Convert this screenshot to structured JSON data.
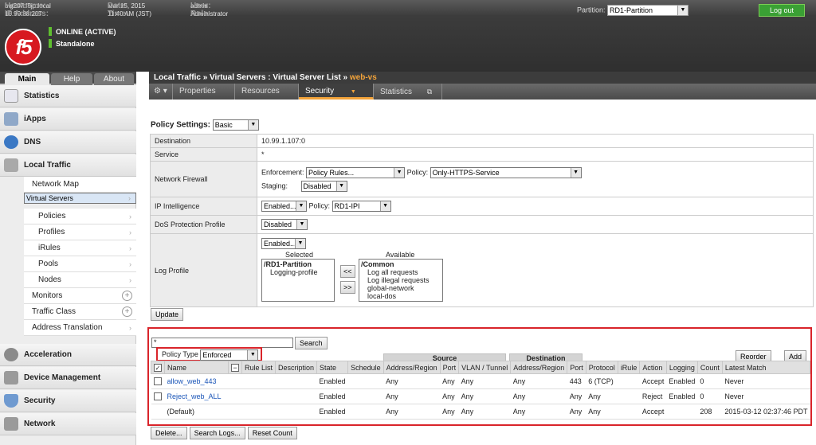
{
  "header": {
    "hostname_label": "Hostname:",
    "hostname": "big207.f5jp.local",
    "ip_label": "IP Address:",
    "ip": "10.99.88.207",
    "date_label": "Date:",
    "date": "Mar 15, 2015",
    "time_label": "Time:",
    "time": "11:40 AM (JST)",
    "user_label": "User:",
    "user": "admin",
    "role_label": "Role:",
    "role": "Administrator",
    "logo": "f5",
    "status_line1": "ONLINE (ACTIVE)",
    "status_line2": "Standalone",
    "partition_label": "Partition:",
    "partition_value": "RD1-Partition",
    "logout": "Log out"
  },
  "sidebar": {
    "tabs": [
      "Main",
      "Help",
      "About"
    ],
    "items": [
      {
        "label": "Statistics",
        "icon": "statistics-icon"
      },
      {
        "label": "iApps",
        "icon": "iapps-icon"
      },
      {
        "label": "DNS",
        "icon": "dns-icon"
      },
      {
        "label": "Local Traffic",
        "icon": "local-traffic-icon"
      }
    ],
    "local_traffic": [
      "Network Map",
      "Virtual Servers",
      "Policies",
      "Profiles",
      "iRules",
      "Pools",
      "Nodes",
      "Monitors",
      "Traffic Class",
      "Address Translation"
    ],
    "bottom": [
      {
        "label": "Acceleration",
        "icon": "acceleration-icon"
      },
      {
        "label": "Device Management",
        "icon": "device-management-icon"
      },
      {
        "label": "Security",
        "icon": "security-icon"
      },
      {
        "label": "Network",
        "icon": "network-icon"
      }
    ]
  },
  "page": {
    "crumb1": "Local Traffic",
    "sep": "»",
    "crumb2": "Virtual Servers : Virtual Server List",
    "current": "web-vs",
    "tabs": [
      "Properties",
      "Resources",
      "Security",
      "Statistics"
    ],
    "gear": "⚙ ▾"
  },
  "policy": {
    "settings_label": "Policy Settings:",
    "settings_value": "Basic",
    "rows": {
      "destination_label": "Destination",
      "destination": "10.99.1.107:0",
      "service_label": "Service",
      "service": "*",
      "firewall_label": "Network Firewall",
      "enforcement_label": "Enforcement:",
      "enforcement": "Policy Rules...",
      "policy_label": "Policy:",
      "fw_policy": "Only-HTTPS-Service",
      "staging_label": "Staging:",
      "staging": "Disabled",
      "ipi_label": "IP Intelligence",
      "ipi_enabled": "Enabled...",
      "ipi_policy_label": "Policy:",
      "ipi_policy": "RD1-IPI",
      "dos_label": "DoS Protection Profile",
      "dos": "Disabled",
      "log_label": "Log Profile",
      "log_enabled": "Enabled...",
      "selected_label": "Selected",
      "available_label": "Available",
      "selected": [
        "/RD1-Partition",
        "Logging-profile"
      ],
      "available": [
        "/Common",
        "Log all requests",
        "Log illegal requests",
        "global-network",
        "local-dos"
      ],
      "move_left": "<<",
      "move_right": ">>"
    },
    "update": "Update"
  },
  "rules": {
    "search_value": "*",
    "search_btn": "Search",
    "policy_type_label": "Policy Type",
    "policy_type": "Enforced",
    "reorder": "Reorder",
    "add": "Add",
    "group_source": "Source",
    "group_destination": "Destination",
    "columns": [
      "Name",
      "Rule List",
      "Description",
      "State",
      "Schedule",
      "Address/Region",
      "Port",
      "VLAN / Tunnel",
      "Address/Region",
      "Port",
      "Protocol",
      "iRule",
      "Action",
      "Logging",
      "Count",
      "Latest Match"
    ],
    "rows": [
      {
        "name": "allow_web_443",
        "state": "Enabled",
        "saddr": "Any",
        "sport": "Any",
        "vlan": "Any",
        "daddr": "Any",
        "dport": "443",
        "proto": "6 (TCP)",
        "action": "Accept",
        "logging": "Enabled",
        "count": "0",
        "latest": "Never"
      },
      {
        "name": "Reject_web_ALL",
        "state": "Enabled",
        "saddr": "Any",
        "sport": "Any",
        "vlan": "Any",
        "daddr": "Any",
        "dport": "Any",
        "proto": "Any",
        "action": "Reject",
        "logging": "Enabled",
        "count": "0",
        "latest": "Never"
      },
      {
        "name": "(Default)",
        "state": "Enabled",
        "saddr": "Any",
        "sport": "Any",
        "vlan": "Any",
        "daddr": "Any",
        "dport": "Any",
        "proto": "Any",
        "action": "Accept",
        "logging": "",
        "count": "208",
        "latest": "2015-03-12 02:37:46 PDT"
      }
    ],
    "buttons": [
      "Delete...",
      "Search Logs...",
      "Reset Count"
    ]
  },
  "colors": {
    "highlight": "#d9242a",
    "accent": "#f2a33a",
    "online": "#5fbf2f",
    "link": "#1a55b8"
  }
}
